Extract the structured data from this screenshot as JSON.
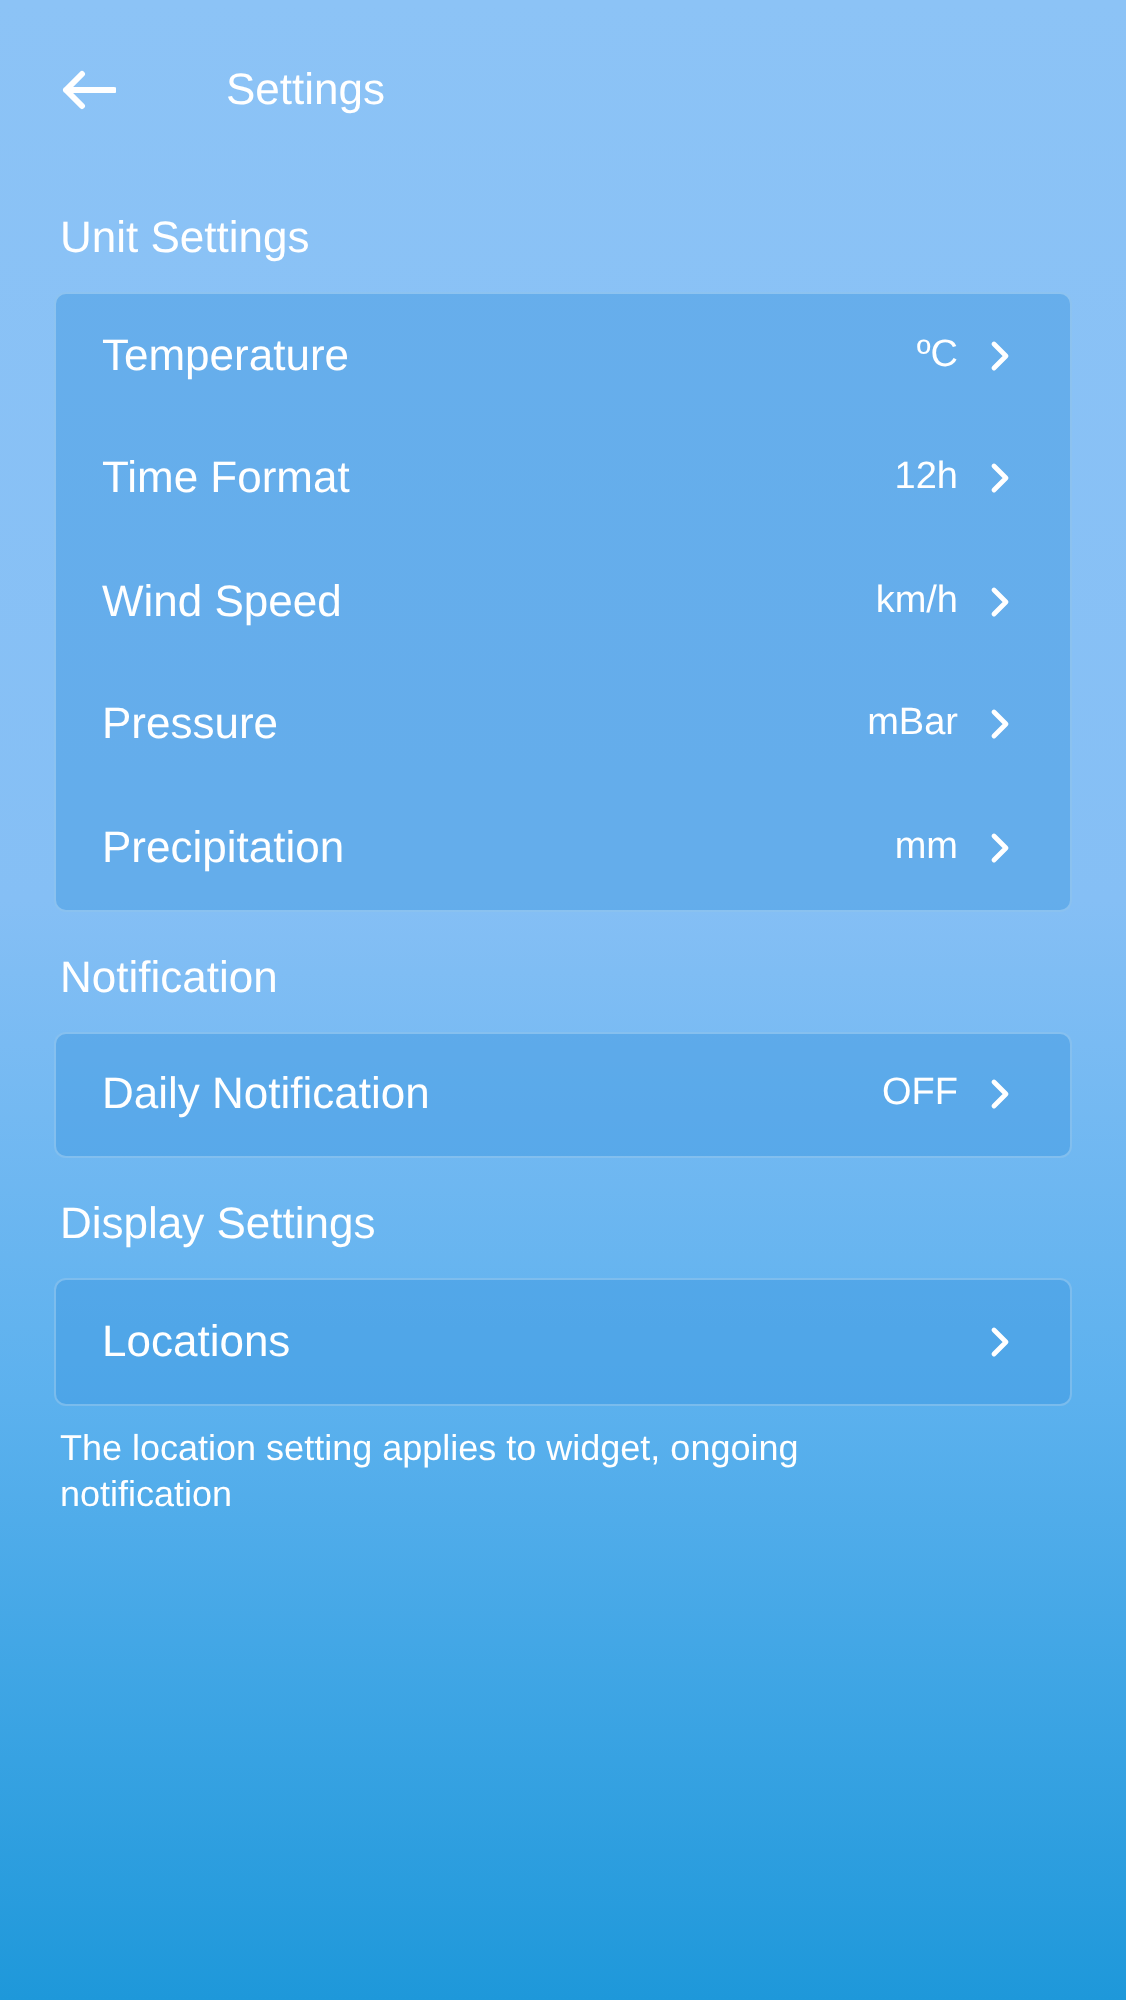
{
  "header": {
    "title": "Settings"
  },
  "sections": [
    {
      "title": "Unit Settings",
      "rows": [
        {
          "label": "Temperature",
          "value": "ºC"
        },
        {
          "label": "Time Format",
          "value": "12h"
        },
        {
          "label": "Wind Speed",
          "value": "km/h"
        },
        {
          "label": "Pressure",
          "value": "mBar"
        },
        {
          "label": "Precipitation",
          "value": "mm"
        }
      ]
    },
    {
      "title": "Notification",
      "rows": [
        {
          "label": "Daily Notification",
          "value": "OFF"
        }
      ]
    },
    {
      "title": "Display Settings",
      "rows": [
        {
          "label": "Locations"
        }
      ],
      "note": "The location setting applies to widget, ongoing notification"
    }
  ]
}
